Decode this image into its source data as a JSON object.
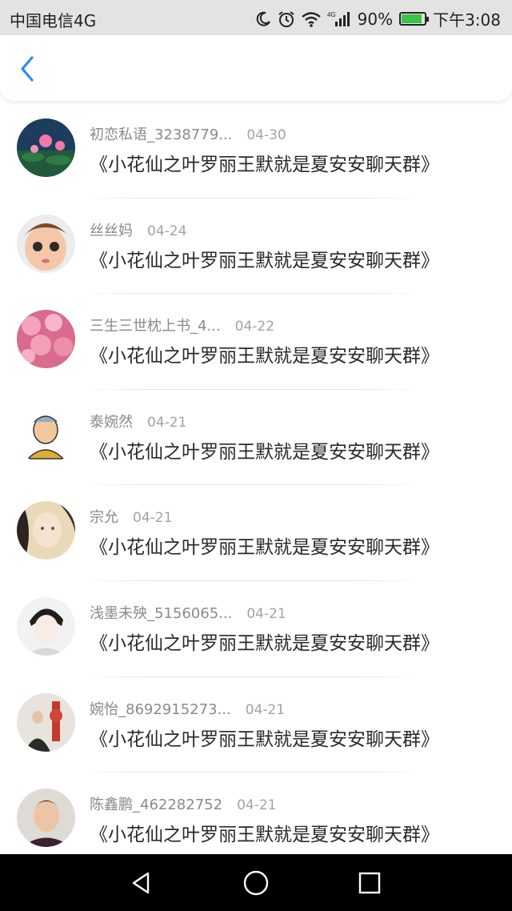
{
  "status_bar": {
    "carrier": "中国电信4G",
    "network": "4G",
    "battery_percent": "90%",
    "battery_level": 0.9,
    "time": "下午3:08",
    "icons": [
      "moon-icon",
      "alarm-icon",
      "wifi-icon",
      "signal-icon",
      "battery-icon"
    ]
  },
  "header": {
    "back_icon": "chevron-left-icon",
    "accent_color": "#2a8cf0"
  },
  "items": [
    {
      "name": "初恋私语_3238779...",
      "date": "04-30",
      "message": "《小花仙之叶罗丽王默就是夏安安聊天群》"
    },
    {
      "name": "丝丝妈",
      "date": "04-24",
      "message": "《小花仙之叶罗丽王默就是夏安安聊天群》"
    },
    {
      "name": "三生三世枕上书_4...",
      "date": "04-22",
      "message": "《小花仙之叶罗丽王默就是夏安安聊天群》"
    },
    {
      "name": "泰婉然",
      "date": "04-21",
      "message": "《小花仙之叶罗丽王默就是夏安安聊天群》"
    },
    {
      "name": "宗允",
      "date": "04-21",
      "message": "《小花仙之叶罗丽王默就是夏安安聊天群》"
    },
    {
      "name": "浅墨未殃_5156065...",
      "date": "04-21",
      "message": "《小花仙之叶罗丽王默就是夏安安聊天群》"
    },
    {
      "name": "婉怡_8692915273...",
      "date": "04-21",
      "message": "《小花仙之叶罗丽王默就是夏安安聊天群》"
    },
    {
      "name": "陈鑫鹏_462282752",
      "date": "04-21",
      "message": "《小花仙之叶罗丽王默就是夏安安聊天群》"
    }
  ],
  "nav_bar": {
    "icons": [
      "back-triangle-icon",
      "home-circle-icon",
      "recents-square-icon"
    ]
  }
}
